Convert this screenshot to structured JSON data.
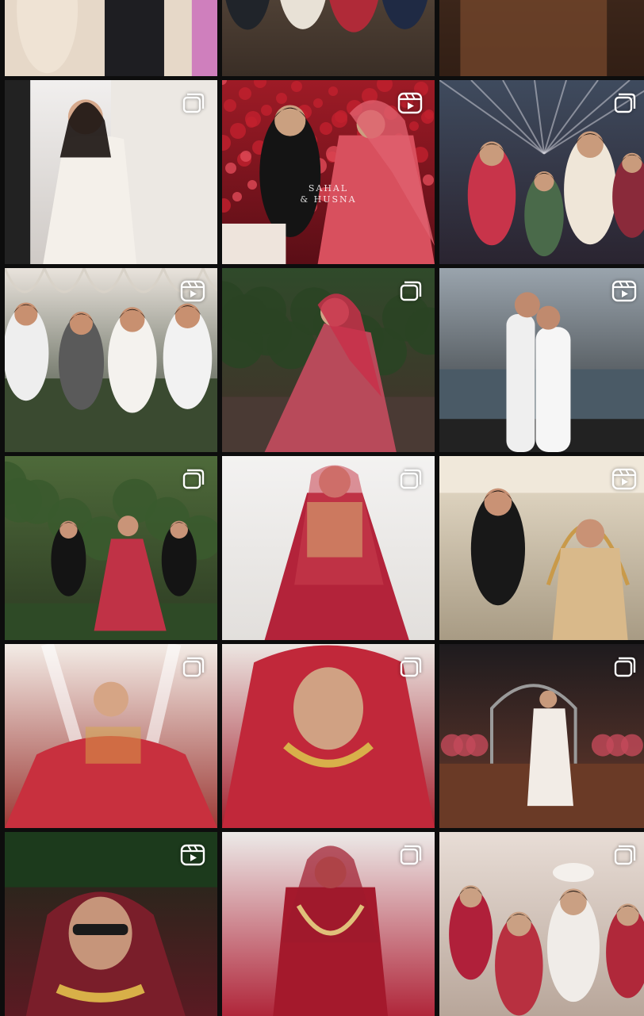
{
  "grid": {
    "tiles": [
      {
        "id": "t0",
        "badge": "none",
        "caption": "",
        "bg": [
          "#e9ddd2",
          "#c8b8aa"
        ],
        "accent": "#2a2a2a",
        "skin": "#d8b39a",
        "scene": "party"
      },
      {
        "id": "t1",
        "badge": "none",
        "caption": "",
        "bg": [
          "#6b5a4a",
          "#3a2e26"
        ],
        "accent": "#b8323a",
        "skin": "#c89a7a",
        "scene": "group"
      },
      {
        "id": "t2",
        "badge": "none",
        "caption": "",
        "bg": [
          "#5a3b2a",
          "#2a1a12"
        ],
        "accent": "#8a5a3a",
        "skin": "#c08a6a",
        "scene": "warm"
      },
      {
        "id": "t3",
        "badge": "multiple-icon",
        "caption": "",
        "bg": [
          "#f1efee",
          "#cfcac6"
        ],
        "accent": "#f3f1ee",
        "skin": "#d6a98c",
        "scene": "gown"
      },
      {
        "id": "t4",
        "badge": "reel-icon",
        "caption": "SAHAL\n& HUSNA",
        "bg": [
          "#9e1b26",
          "#5a0e16"
        ],
        "accent": "#d45a6a",
        "skin": "#caa080",
        "scene": "couple-flowers"
      },
      {
        "id": "t5",
        "badge": "multiple-icon",
        "caption": "",
        "bg": [
          "#3f4b5e",
          "#2a2430"
        ],
        "accent": "#c8344a",
        "skin": "#c99b7c",
        "scene": "ceremony"
      },
      {
        "id": "t6",
        "badge": "reel-icon",
        "caption": "",
        "bg": [
          "#e9e3dc",
          "#2e3a2a"
        ],
        "accent": "#ffffff",
        "skin": "#c89070",
        "scene": "friends"
      },
      {
        "id": "t7",
        "badge": "multiple-icon",
        "caption": "",
        "bg": [
          "#2f4a2a",
          "#44302a"
        ],
        "accent": "#c8304a",
        "skin": "#d4a488",
        "scene": "bride-garden"
      },
      {
        "id": "t8",
        "badge": "reel-icon",
        "caption": "",
        "bg": [
          "#9aa4ad",
          "#2a2e30"
        ],
        "accent": "#efefef",
        "skin": "#c08a6e",
        "scene": "beach"
      },
      {
        "id": "t9",
        "badge": "multiple-icon",
        "caption": "",
        "bg": [
          "#4e6a3a",
          "#2c3a22"
        ],
        "accent": "#c03246",
        "skin": "#c99478",
        "scene": "dance"
      },
      {
        "id": "t10",
        "badge": "multiple-icon",
        "caption": "",
        "bg": [
          "#f3f2f1",
          "#e2dfdc"
        ],
        "accent": "#b3233a",
        "skin": "#d6a78a",
        "scene": "bride-studio"
      },
      {
        "id": "t11",
        "badge": "reel-icon",
        "caption": "",
        "bg": [
          "#e9dfcc",
          "#a89b84"
        ],
        "accent": "#d9b98a",
        "skin": "#c99275",
        "scene": "couple-cart"
      },
      {
        "id": "t12",
        "badge": "multiple-icon",
        "caption": "",
        "bg": [
          "#f3ece6",
          "#9c3a36"
        ],
        "accent": "#c8303e",
        "skin": "#d6a585",
        "scene": "bride-veil"
      },
      {
        "id": "t13",
        "badge": "multiple-icon",
        "caption": "",
        "bg": [
          "#ece6e2",
          "#a3202e"
        ],
        "accent": "#c1283a",
        "skin": "#d0a183",
        "scene": "bride-close"
      },
      {
        "id": "t14",
        "badge": "multiple-icon",
        "caption": "",
        "bg": [
          "#1e1b1e",
          "#6a3a2c"
        ],
        "accent": "#f2ece6",
        "skin": "#c89a7c",
        "scene": "entrance"
      },
      {
        "id": "t15",
        "badge": "reel-icon",
        "caption": "",
        "bg": [
          "#1a2a1a",
          "#5a1a22"
        ],
        "accent": "#d8b048",
        "skin": "#c6957a",
        "scene": "bride-party"
      },
      {
        "id": "t16",
        "badge": "multiple-icon",
        "caption": "",
        "bg": [
          "#eceae8",
          "#b0263a"
        ],
        "accent": "#a4192c",
        "skin": "#d3a486",
        "scene": "bride-stand"
      },
      {
        "id": "t17",
        "badge": "multiple-icon",
        "caption": "",
        "bg": [
          "#e8ddd6",
          "#b8a69a"
        ],
        "accent": "#f0ece8",
        "skin": "#caa083",
        "scene": "crowd"
      }
    ]
  }
}
